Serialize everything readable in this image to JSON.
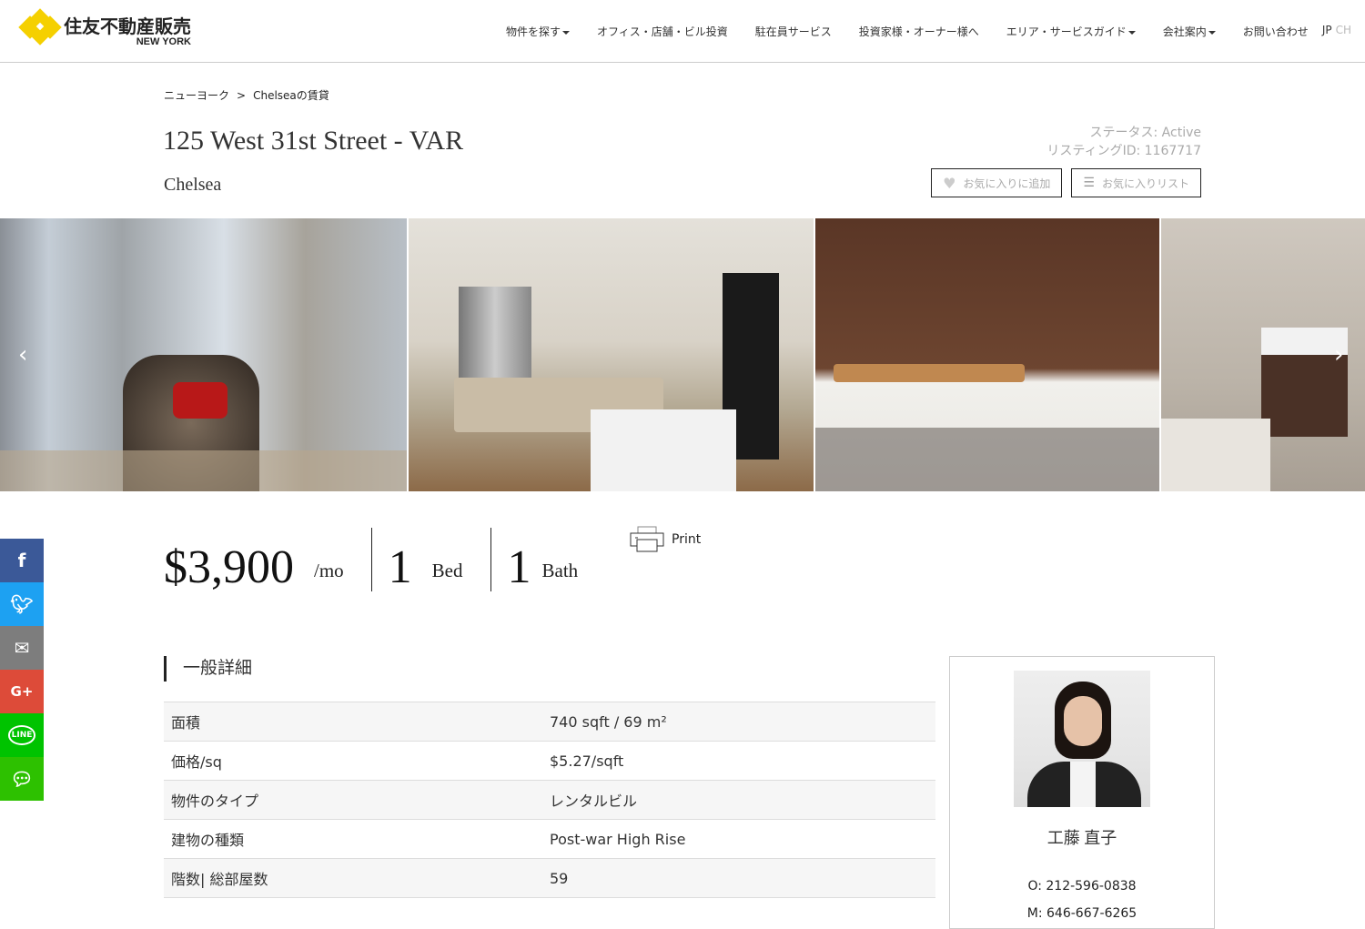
{
  "header": {
    "logo_text": "住友不動産販売",
    "logo_sub": "NEW YORK",
    "nav": [
      {
        "label": "物件を探す",
        "dropdown": true
      },
      {
        "label": "オフィス・店舗・ビル投資",
        "dropdown": false
      },
      {
        "label": "駐在員サービス",
        "dropdown": false
      },
      {
        "label": "投資家様・オーナー様へ",
        "dropdown": false
      },
      {
        "label": "エリア・サービスガイド",
        "dropdown": true
      },
      {
        "label": "会社案内",
        "dropdown": true
      },
      {
        "label": "お問い合わせ",
        "dropdown": false
      }
    ],
    "lang": {
      "jp": "JP",
      "ch": "CH"
    }
  },
  "breadcrumb": {
    "items": [
      "ニューヨーク",
      "Chelseaの賃貸"
    ],
    "separator": ">"
  },
  "listing": {
    "title": "125 West 31st Street - VAR",
    "neighborhood": "Chelsea",
    "status": "ステータス: Active",
    "listing_id": "リスティングID: 1167717",
    "fav_add": "お気に入りに追加",
    "fav_list": "お気に入りリスト"
  },
  "gallery": {
    "prev": "‹",
    "next": "›"
  },
  "summary": {
    "price": "$3,900",
    "price_unit": "/mo",
    "beds": "1",
    "beds_label": "Bed",
    "baths": "1",
    "baths_label": "Bath",
    "print": "Print"
  },
  "social": [
    "facebook",
    "twitter",
    "email",
    "google-plus",
    "line",
    "wechat"
  ],
  "details": {
    "heading": "一般詳細",
    "rows": [
      {
        "k": "面積",
        "v": "740 sqft / 69 m²"
      },
      {
        "k": "価格/sq",
        "v": "$5.27/sqft"
      },
      {
        "k": "物件のタイプ",
        "v": "レンタルビル"
      },
      {
        "k": "建物の種類",
        "v": "Post-war High Rise"
      },
      {
        "k": "階数| 総部屋数",
        "v": "59"
      }
    ]
  },
  "agent": {
    "name": "工藤 直子",
    "office": "O: 212-596-0838",
    "mobile": "M: 646-667-6265"
  }
}
